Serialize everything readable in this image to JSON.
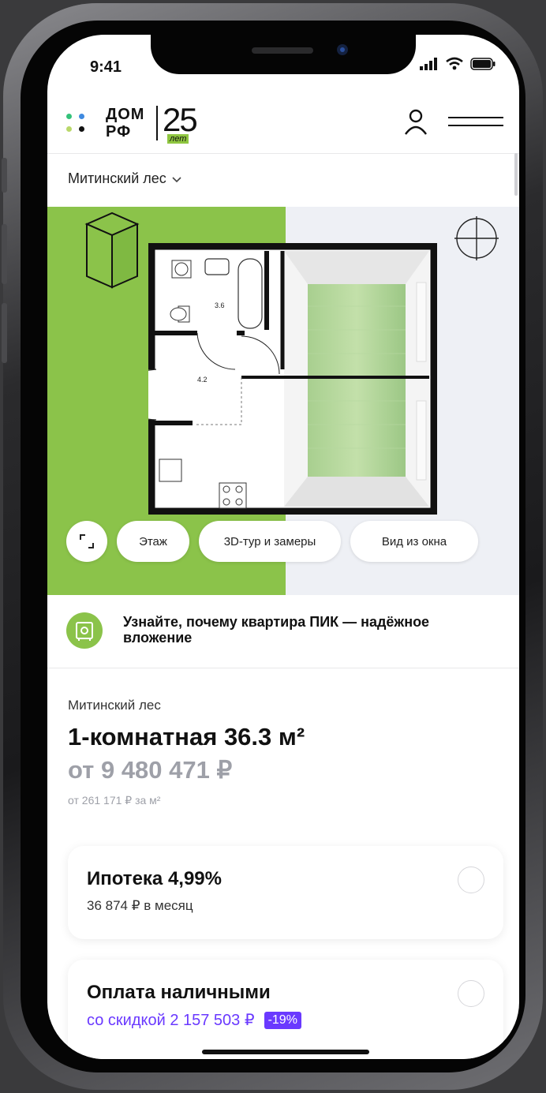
{
  "status": {
    "time": "9:41"
  },
  "header": {
    "logo_line1": "ДОМ",
    "logo_line2": "РФ",
    "logo_number": "25",
    "logo_sub": "лет"
  },
  "project_selector": {
    "label": "Митинский лес"
  },
  "plan": {
    "room_labels": [
      "3.6",
      "4.2"
    ],
    "buttons": {
      "floor": "Этаж",
      "tour": "3D-тур и замеры",
      "window_view": "Вид из окна"
    }
  },
  "banner": {
    "text": "Узнайте, почему квартира ПИК — надёжное вложение"
  },
  "listing": {
    "project": "Митинский лес",
    "title": "1-комнатная 36.3 м²",
    "price": "от 9 480 471 ₽",
    "price_per_meter": "от 261 171 ₽ за м²"
  },
  "payment_options": [
    {
      "title": "Ипотека 4,99%",
      "subtitle": "36 874 ₽ в месяц"
    },
    {
      "title": "Оплата наличными",
      "subtitle": "со скидкой 2 157 503 ₽",
      "badge": "-19%"
    }
  ],
  "colors": {
    "accent_green": "#8bc34a",
    "accent_purple": "#6a39ff",
    "muted_text": "#9ea0a8"
  }
}
